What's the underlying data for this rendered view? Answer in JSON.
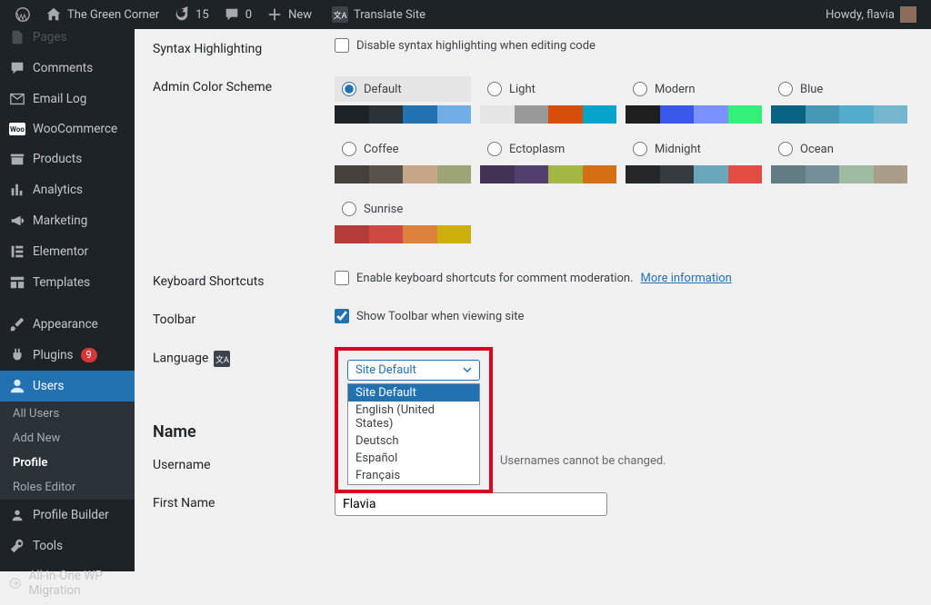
{
  "adminbar": {
    "site_name": "The Green Corner",
    "updates": "15",
    "comments": "0",
    "new": "New",
    "translate": "Translate Site",
    "howdy": "Howdy, flavia"
  },
  "sidebar": {
    "pages": "Pages",
    "comments": "Comments",
    "email_log": "Email Log",
    "woocommerce": "WooCommerce",
    "products": "Products",
    "analytics": "Analytics",
    "marketing": "Marketing",
    "elementor": "Elementor",
    "templates": "Templates",
    "appearance": "Appearance",
    "plugins": "Plugins",
    "plugins_count": "9",
    "users": "Users",
    "all_users": "All Users",
    "add_new": "Add New",
    "profile": "Profile",
    "roles_editor": "Roles Editor",
    "profile_builder": "Profile Builder",
    "tools": "Tools",
    "aio_migration": "All-in-One WP Migration"
  },
  "form": {
    "syntax_label": "Syntax Highlighting",
    "syntax_checkbox": "Disable syntax highlighting when editing code",
    "color_label": "Admin Color Scheme",
    "schemes": {
      "default": "Default",
      "light": "Light",
      "modern": "Modern",
      "blue": "Blue",
      "coffee": "Coffee",
      "ectoplasm": "Ectoplasm",
      "midnight": "Midnight",
      "ocean": "Ocean",
      "sunrise": "Sunrise"
    },
    "kb_label": "Keyboard Shortcuts",
    "kb_checkbox": "Enable keyboard shortcuts for comment moderation.",
    "kb_link": "More information",
    "toolbar_label": "Toolbar",
    "toolbar_checkbox": "Show Toolbar when viewing site",
    "language_label": "Language",
    "language_value": "Site Default",
    "language_options": [
      "Site Default",
      "English (United States)",
      "Deutsch",
      "Español",
      "Français"
    ],
    "name_heading": "Name",
    "username_label": "Username",
    "username_hint": "Usernames cannot be changed.",
    "firstname_label": "First Name",
    "firstname_value": "Flavia"
  }
}
